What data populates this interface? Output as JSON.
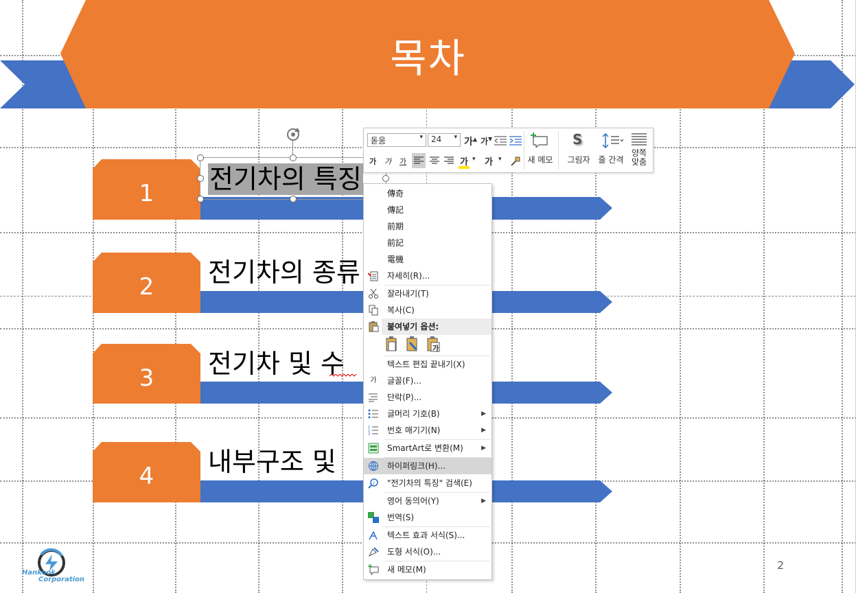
{
  "slide": {
    "title": "목차",
    "items": [
      {
        "number": "1",
        "text": "전기차의 특징"
      },
      {
        "number": "2",
        "text": "전기차의 종류"
      },
      {
        "number": "3",
        "text": "전기차 및 수"
      },
      {
        "number": "4",
        "text": "내부구조 및"
      }
    ],
    "page_number": "2",
    "logo_text": [
      "Hankook",
      "Corporation"
    ],
    "colors": {
      "orange": "#ED7D31",
      "blue": "#4472C4",
      "selection": "#a6a6a6"
    }
  },
  "mini_toolbar": {
    "font_name": "돋움",
    "font_size": "24",
    "grow_font": "가",
    "shrink_font": "가",
    "bold": "가",
    "italic": "가",
    "underline": "가",
    "highlight": "가",
    "font_color": "가",
    "new_comment_label": "새 메모",
    "shape_style_label": "그림자",
    "line_spacing_label": "줄 간격",
    "justify_label": [
      "양쪽",
      "맞춤"
    ],
    "shadow_glyph": "S"
  },
  "context_menu": {
    "suggestions": [
      "傳奇",
      "傳記",
      "前期",
      "前記",
      "電機"
    ],
    "items": {
      "detail": "자세히(R)...",
      "cut": "잘라내기(T)",
      "copy": "복사(C)",
      "paste_options": "붙여넣기 옵션:",
      "paste_text_glyph": "가",
      "exit_edit": "텍스트 편집 끝내기(X)",
      "font": "글꼴(F)...",
      "paragraph": "단락(P)...",
      "bullets": "글머리 기호(B)",
      "numbering": "번호 매기기(N)",
      "smartart": "SmartArt로 변환(M)",
      "hyperlink": "하이퍼링크(H)...",
      "search": "\"전기차의 특징\" 검색(E)",
      "synonyms": "영어 동의어(Y)",
      "translate": "번역(S)",
      "text_effects": "텍스트 효과 서식(S)...",
      "shape_format": "도형 서식(O)...",
      "new_comment": "새 메모(M)"
    },
    "font_icon_glyph": "가"
  }
}
